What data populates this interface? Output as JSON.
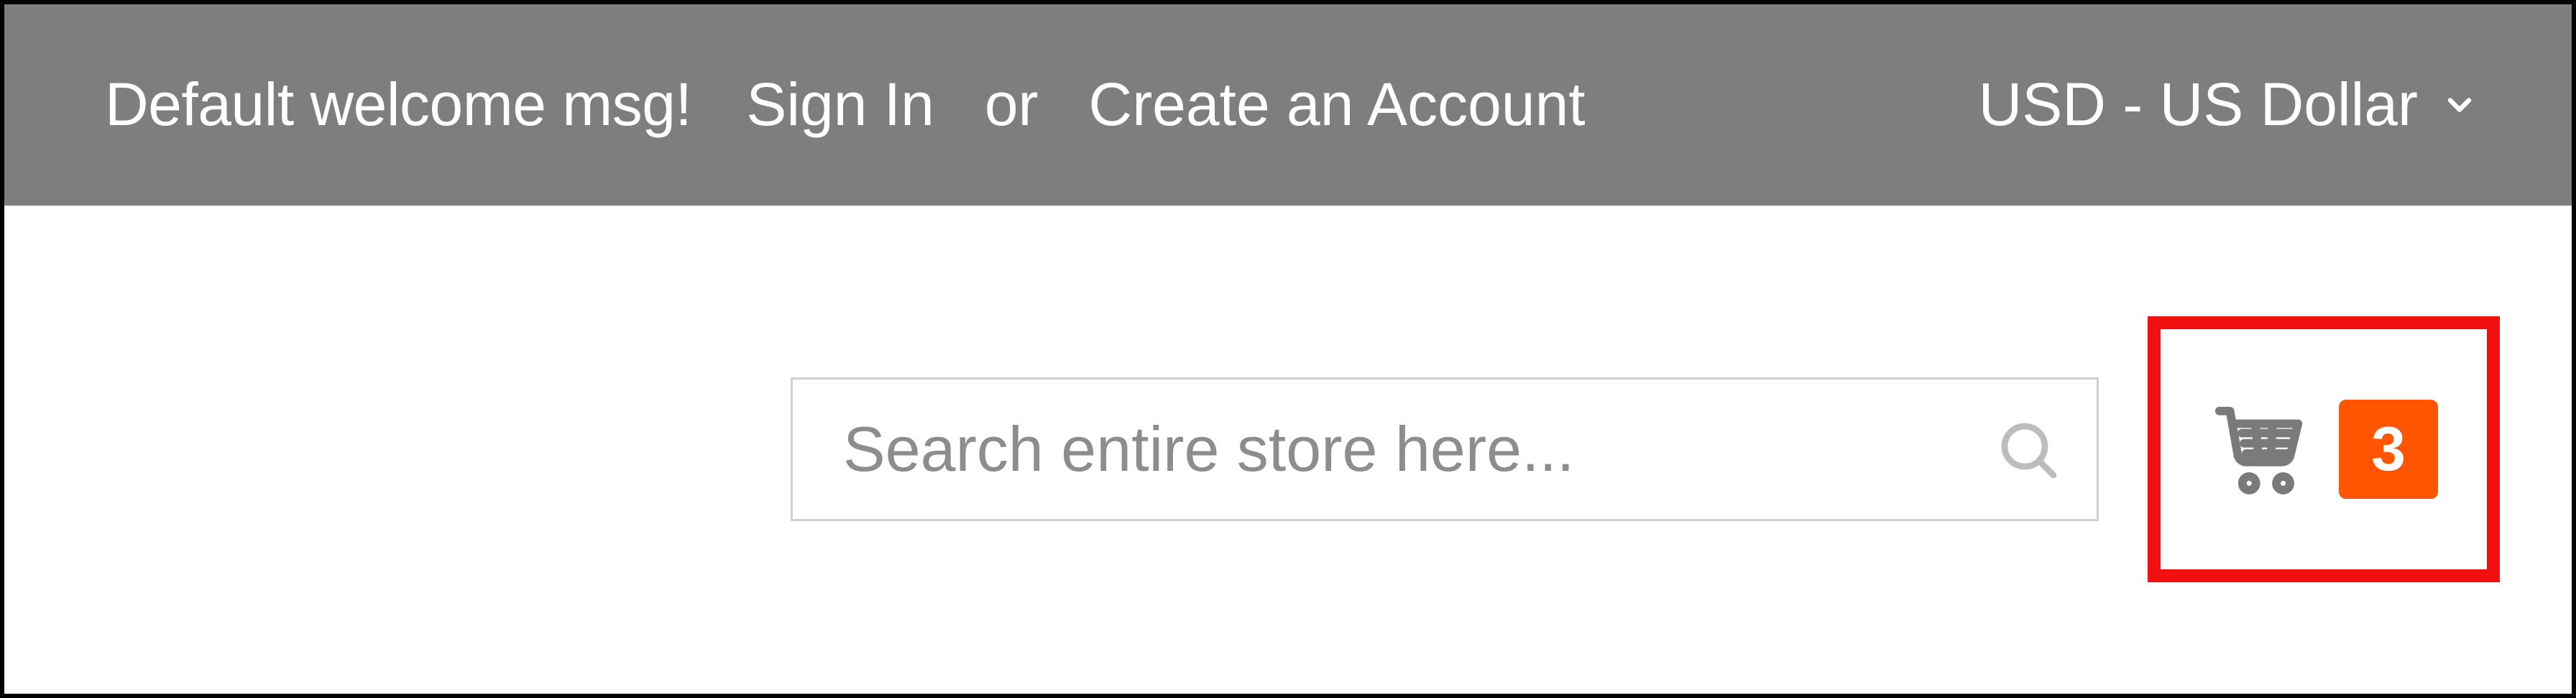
{
  "topbar": {
    "welcome": "Default welcome msg!",
    "sign_in": "Sign In",
    "or": "or",
    "create_account": "Create an Account",
    "currency_label": "USD - US Dollar"
  },
  "search": {
    "placeholder": "Search entire store here..."
  },
  "cart": {
    "count": "3"
  }
}
